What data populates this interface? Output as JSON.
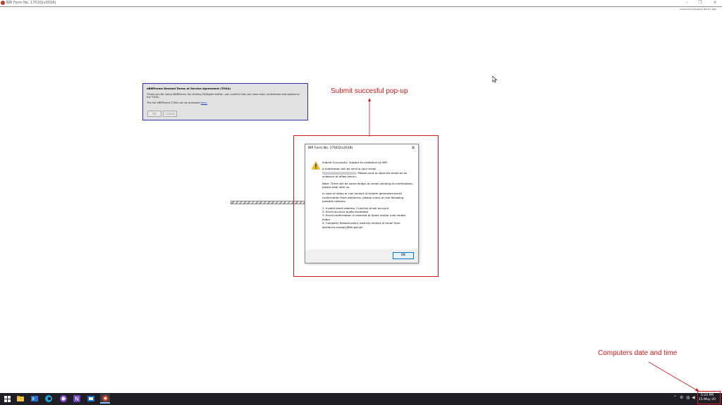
{
  "window": {
    "title": "BIR Form No. 1701Q(v2018)",
    "minimize": "–",
    "maximize": "❐",
    "close": "✕",
    "gov_note": "Government Property Not For Sale"
  },
  "tosa": {
    "title": "eBIRForms Revised Terms of Service Agreement (TOSA)",
    "line1": "Thank you for using eBIRForms. By clicking Ok/Agree button, you confirm that you have read, understood and agreed to the TOSA.",
    "line2_prefix": "The full eBIRForms TOSA can be accessed ",
    "link": "here.",
    "ok": "Ok",
    "cancel": "Cancel"
  },
  "annotations": {
    "popup_label": "Submit succesful pop-up",
    "clock_label": "Computers date and time",
    "color": "#d11a1a"
  },
  "msgbox": {
    "title": "BIR Form No. 1701Q(v2018)",
    "close": "✕",
    "icon": "warning-icon",
    "line1": "Submit Successful. Subject to validation by BIR.",
    "line2a": "A notification will be sent to your email",
    "line2b": ". Please print or save the email as an evidence of efiled return.",
    "line3": "Note: There will be some delays on email sending of confirmation, please bear with us.",
    "line4": "In case of delay or non receipt of system generated email confirmation from ebirforms, please check on the following possible reasons:",
    "reasons": [
      "1. Invalid email address / inactive email account",
      "2. Email account quota exceeded",
      "3. Email confirmation is diverted to Spam and/or Junk emails folder",
      "4. Company firewall policy restricts receipt of email from ebirforms-noreply@bir.gov.ph"
    ],
    "ok": "OK"
  },
  "taskbar": {
    "time": "5:24 PM",
    "date": "15-May-20"
  }
}
